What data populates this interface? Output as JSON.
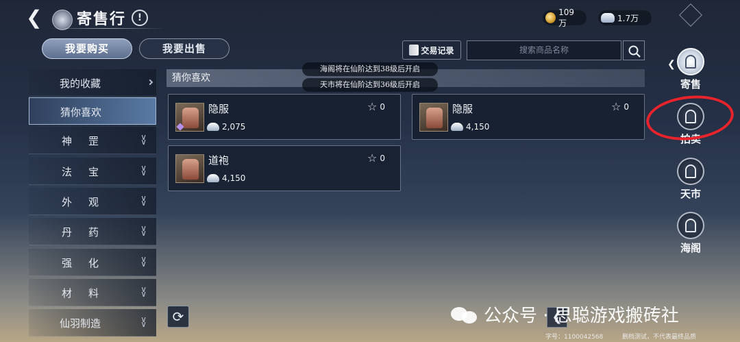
{
  "header": {
    "title": "寄售行",
    "info_label": "!",
    "gold_amount": "109万",
    "silver_amount": "1.7万"
  },
  "mode_tabs": {
    "buy": "我要购买",
    "sell": "我要出售"
  },
  "toolbar": {
    "trade_record": "交易记录",
    "search_placeholder": "搜索商品名称"
  },
  "categories": [
    {
      "label": "我的收藏",
      "active": false
    },
    {
      "label": "猜你喜欢",
      "active": true
    },
    {
      "label": "神罡",
      "active": false
    },
    {
      "label": "法宝",
      "active": false
    },
    {
      "label": "外观",
      "active": false
    },
    {
      "label": "丹药",
      "active": false
    },
    {
      "label": "强化",
      "active": false
    },
    {
      "label": "材料",
      "active": false
    },
    {
      "label": "仙羽制造",
      "active": false
    }
  ],
  "section": {
    "title": "猜你喜欢",
    "notices": [
      "海阁将在仙阶达到38级后开启",
      "天市将在仙阶达到36级后开启"
    ]
  },
  "items": [
    {
      "name": "隐服",
      "price": "2,075",
      "favorites": "0"
    },
    {
      "name": "隐服",
      "price": "4,150",
      "favorites": "0"
    },
    {
      "name": "道袍",
      "price": "4,150",
      "favorites": "0"
    }
  ],
  "right_nav": [
    {
      "label": "寄售",
      "active": true
    },
    {
      "label": "拍卖",
      "active": false
    },
    {
      "label": "天市",
      "active": false
    },
    {
      "label": "海阁",
      "active": false
    }
  ],
  "watermark": "公众号 · 思聪游戏搬砖社",
  "footer": {
    "id_text": "字号：1100042568",
    "disclaimer": "删档测试，不代表最终品质"
  },
  "colors": {
    "highlight_circle": "#e8232b",
    "accent": "#8fa0bd"
  }
}
